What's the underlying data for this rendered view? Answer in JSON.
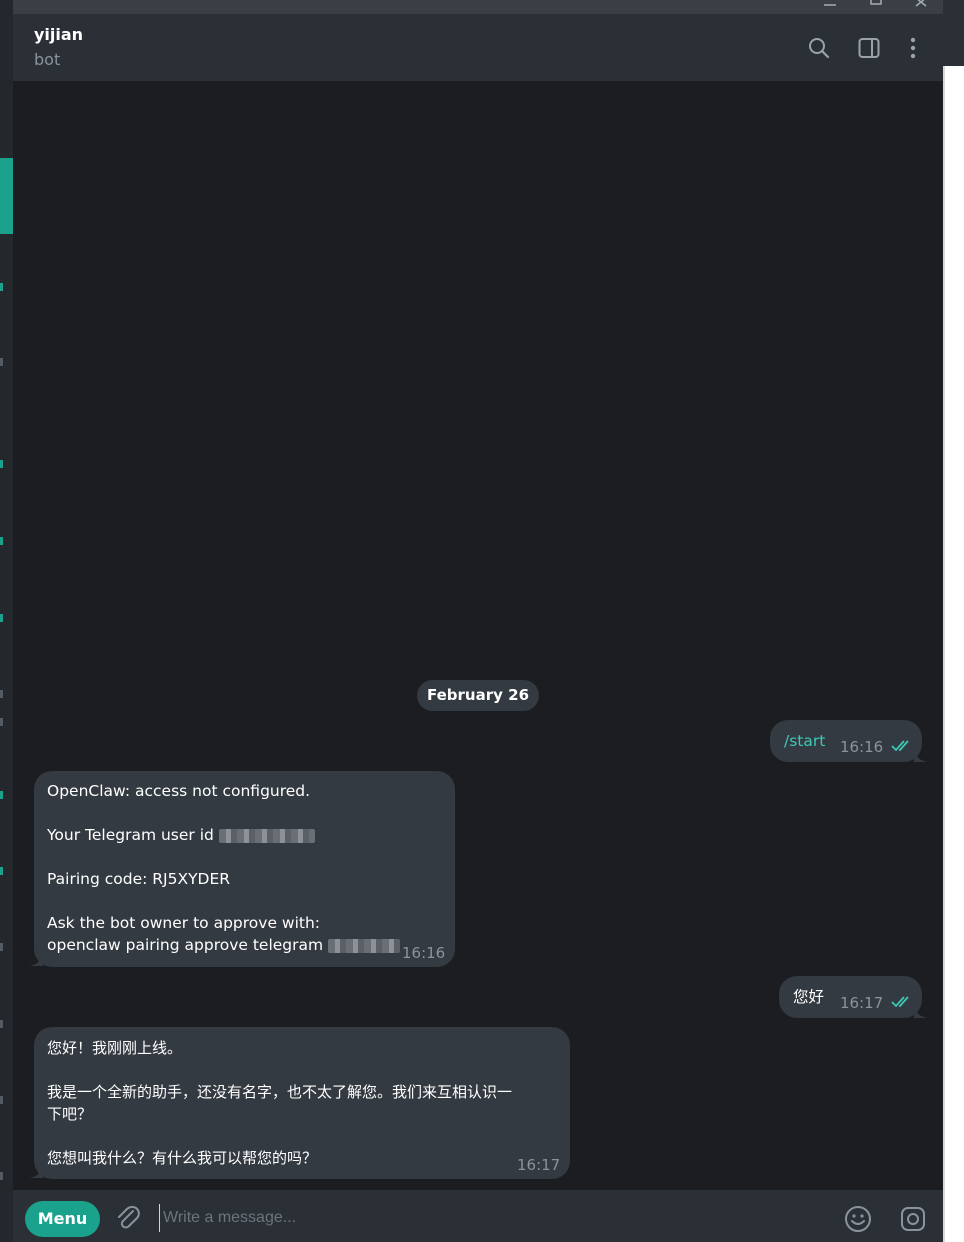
{
  "header": {
    "title": "yijian",
    "subtitle": "bot"
  },
  "chat": {
    "date_separator": "February 26",
    "messages": [
      {
        "direction": "outgoing",
        "text": "/start",
        "time": "16:16",
        "status": "read"
      },
      {
        "direction": "incoming",
        "lines": [
          "OpenClaw: access not configured.",
          "Your Telegram user id",
          "Pairing code: RJ5XYDER",
          "Ask the bot owner to approve with:",
          "openclaw pairing approve telegram"
        ],
        "time": "16:16"
      },
      {
        "direction": "outgoing",
        "text": "您好",
        "time": "16:17",
        "status": "read"
      },
      {
        "direction": "incoming",
        "lines": [
          "您好！我刚刚上线。",
          "我是一个全新的助手，还没有名字，也不太了解您。我们来互相认识一",
          "下吧？",
          "您想叫我什么？有什么我可以帮您的吗？"
        ],
        "time": "16:17"
      }
    ]
  },
  "composer": {
    "menu_label": "Menu",
    "placeholder": "Write a message..."
  },
  "colors": {
    "accent": "#1aa28c",
    "bubble": "#343a41",
    "background": "#1c1d21",
    "header": "#2b3036",
    "check_marks": "#3ec9b5"
  },
  "icons": [
    "search-icon",
    "sidebar-toggle-icon",
    "more-vertical-icon",
    "attach-icon",
    "emoji-icon",
    "instagram-style-camera-icon",
    "double-check-icon",
    "minimize-icon",
    "maximize-icon",
    "close-icon"
  ]
}
